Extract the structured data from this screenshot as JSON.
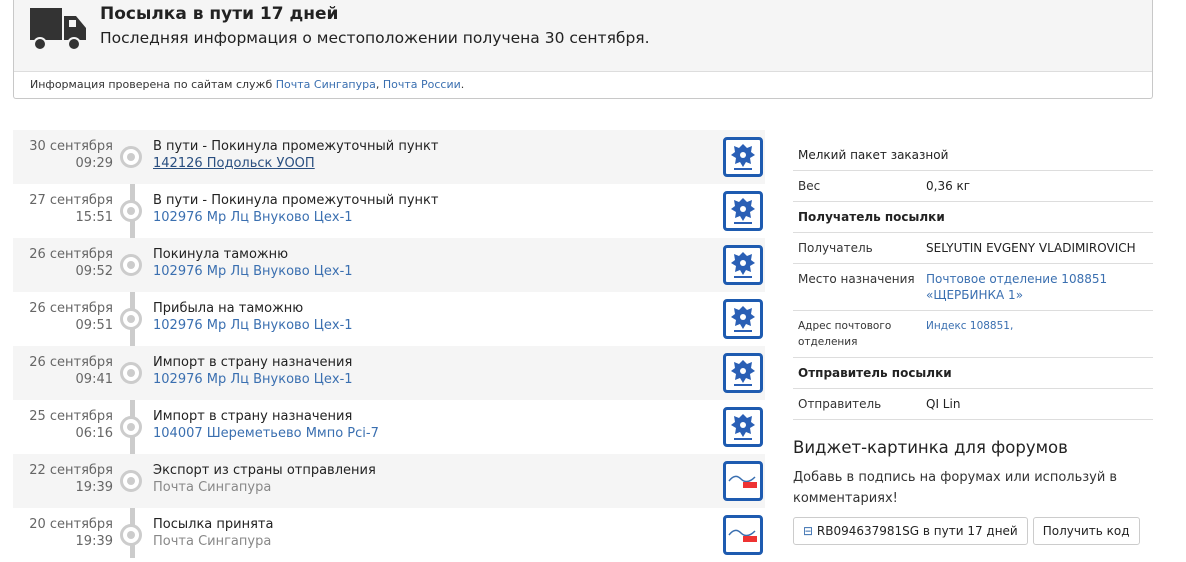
{
  "header": {
    "title": "Посылка в пути 17 дней",
    "subtitle": "Последняя информация о местоположении получена 30 сентября.",
    "info_prefix": "Информация проверена по сайтам служб ",
    "link1": "Почта Сингапура",
    "sep": ", ",
    "link2": "Почта России",
    "suffix": "."
  },
  "events": [
    {
      "date": "30 сентября",
      "time": "09:29",
      "status": "В пути - Покинула промежуточный пункт",
      "location": "142126 Подольск УООП",
      "carrier": "russian-post"
    },
    {
      "date": "27 сентября",
      "time": "15:51",
      "status": "В пути - Покинула промежуточный пункт",
      "location": "102976 Мр Лц Внуково Цех-1",
      "carrier": "russian-post"
    },
    {
      "date": "26 сентября",
      "time": "09:52",
      "status": "Покинула таможню",
      "location": "102976 Мр Лц Внуково Цех-1",
      "carrier": "russian-post"
    },
    {
      "date": "26 сентября",
      "time": "09:51",
      "status": "Прибыла на таможню",
      "location": "102976 Мр Лц Внуково Цех-1",
      "carrier": "russian-post"
    },
    {
      "date": "26 сентября",
      "time": "09:41",
      "status": "Импорт в страну назначения",
      "location": "102976 Мр Лц Внуково Цех-1",
      "carrier": "russian-post"
    },
    {
      "date": "25 сентября",
      "time": "06:16",
      "status": "Импорт в страну назначения",
      "location": "104007 Шереметьево Ммпо Pci-7",
      "carrier": "russian-post"
    },
    {
      "date": "22 сентября",
      "time": "19:39",
      "status": "Экспорт из страны отправления",
      "location": "Почта Сингапура",
      "carrier": "singapore-post"
    },
    {
      "date": "20 сентября",
      "time": "19:39",
      "status": "Посылка принята",
      "location": "Почта Сингапура",
      "carrier": "singapore-post"
    }
  ],
  "details": {
    "type": "Мелкий пакет заказной",
    "weight_label": "Вес",
    "weight": "0,36 кг",
    "recipient_header": "Получатель посылки",
    "recipient_label": "Получатель",
    "recipient": "SELYUTIN EVGENY VLADIMIROVICH",
    "dest_label": "Место назначения",
    "dest": "Почтовое отделение 108851 «ЩЕРБИНКА 1»",
    "addr_label": "Адрес почтового отделения",
    "addr": "Индекс 108851,",
    "sender_header": "Отправитель посылки",
    "sender_label": "Отправитель",
    "sender": "QI Lin"
  },
  "widget": {
    "title": "Виджет-картинка для форумов",
    "text": "Добавь в подпись на форумах или используй в комментариях!",
    "preview": "RB094637981SG в пути 17 дней",
    "button": "Получить код"
  },
  "colors": {
    "link": "#3a6fb0",
    "logo_border": "#1e5bb0"
  }
}
